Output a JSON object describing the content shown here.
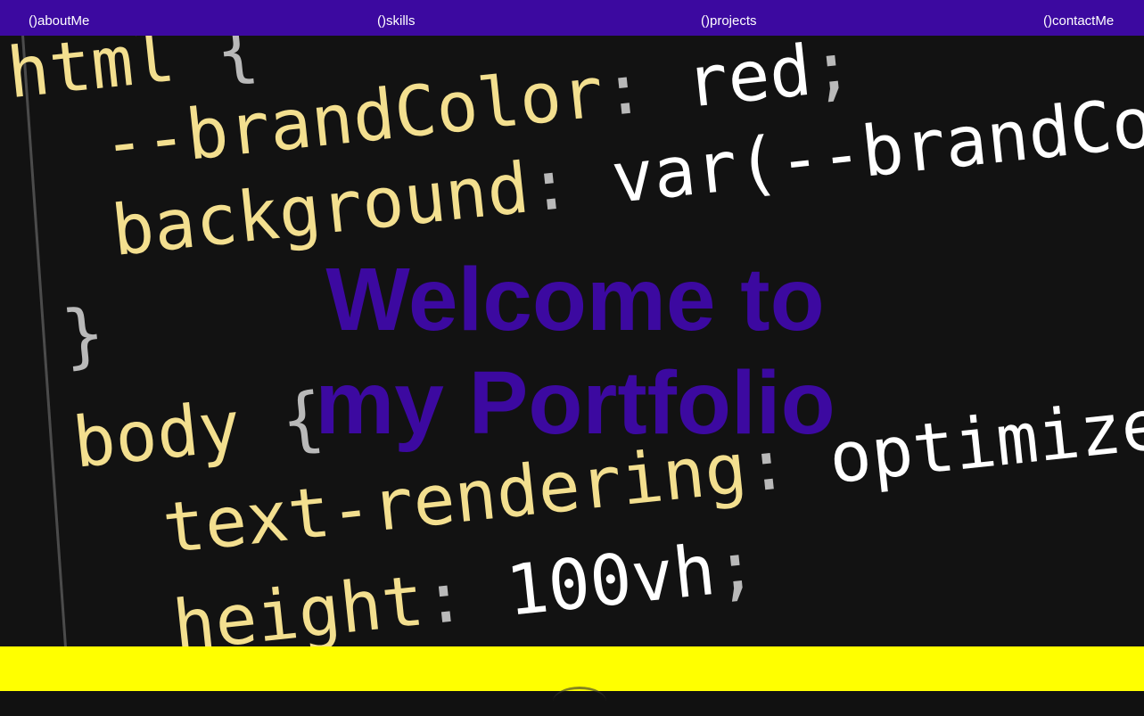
{
  "nav": {
    "items": [
      {
        "label": "()aboutMe"
      },
      {
        "label": "()skills"
      },
      {
        "label": "()projects"
      },
      {
        "label": "()contactMe"
      }
    ]
  },
  "hero": {
    "background_code": {
      "line1": {
        "sel": "html",
        "brace": " {"
      },
      "line2": {
        "prop": "--brandColor",
        "colon": ":",
        "value": " red",
        "semi": ";"
      },
      "line3": {
        "prop": "background",
        "colon": ":",
        "value": " var(--brandColo"
      },
      "line4": {
        "brace": "}"
      },
      "line5": {
        "sel": "body",
        "brace": " {"
      },
      "line6": {
        "prop": "text-rendering",
        "colon": ":",
        "value": " optimizeSpe"
      },
      "line7": {
        "prop": "height",
        "colon": ":",
        "value": " 100vh",
        "semi": ";"
      }
    },
    "title_line1": "Welcome to",
    "title_line2": "my Portfolio"
  },
  "colors": {
    "brand": "#3c09a0",
    "footer": "#ffff00",
    "code_background": "#121212",
    "code_keyword": "#f3df8f",
    "code_value": "#ffffff"
  }
}
